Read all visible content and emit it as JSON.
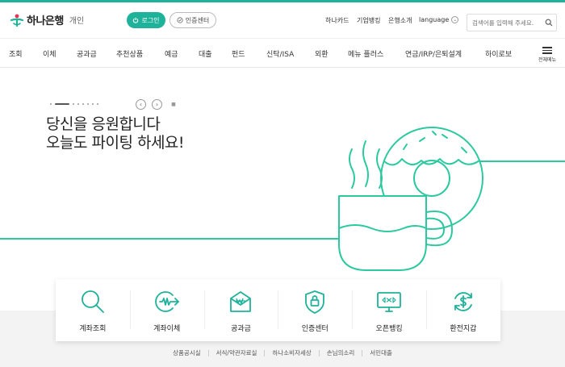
{
  "header": {
    "logo_text": "하나은행",
    "logo_sub": "개인",
    "login_label": "로그인",
    "cert_label": "인증센터",
    "util_links": [
      "하나카드",
      "기업뱅킹",
      "은행소개"
    ],
    "language_label": "language",
    "search_placeholder": "검색어를 입력해 주세요."
  },
  "gnb": {
    "items": [
      "조회",
      "이체",
      "공과금",
      "추천상품",
      "예금",
      "대출",
      "펀드",
      "신탁/ISA",
      "외환",
      "메뉴 플러스",
      "연금/IRP/은퇴설계",
      "하이로보"
    ],
    "all_menu_label": "전체메뉴"
  },
  "hero": {
    "line1": "당신을 응원합니다",
    "line2": "오늘도 파이팅 하세요!"
  },
  "quick_menu": [
    {
      "label": "계좌조회",
      "icon": "magnifier-icon"
    },
    {
      "label": "계좌이체",
      "icon": "transfer-icon"
    },
    {
      "label": "공과금",
      "icon": "envelope-won-icon"
    },
    {
      "label": "인증센터",
      "icon": "shield-lock-icon"
    },
    {
      "label": "오픈뱅킹",
      "icon": "monitor-exchange-icon"
    },
    {
      "label": "환전지갑",
      "icon": "dollar-cycle-icon"
    }
  ],
  "footer_links": [
    "상품공시실",
    "서식/약관자료실",
    "하나소비자세상",
    "손님의소리",
    "서민대출"
  ],
  "colors": {
    "accent": "#1fb29a",
    "brand_red": "#e8344e"
  }
}
